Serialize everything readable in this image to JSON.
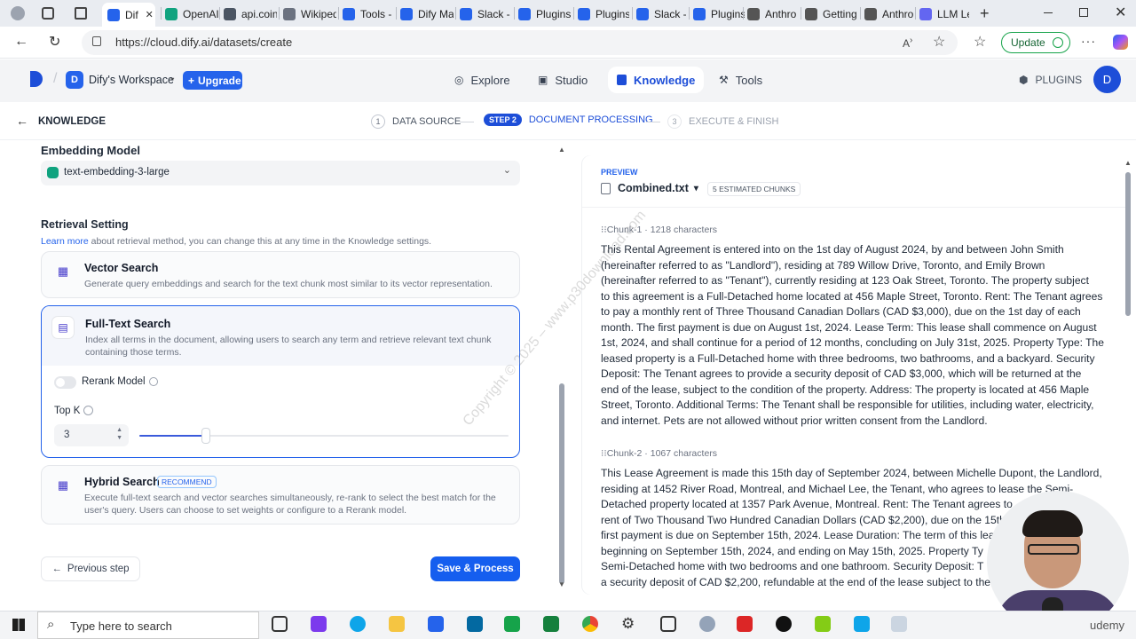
{
  "browser": {
    "tabs": [
      {
        "label": "Dif",
        "color": "#2563eb"
      },
      {
        "label": "OpenAI",
        "color": "#10a37f"
      },
      {
        "label": "api.coin",
        "color": "#4b5563"
      },
      {
        "label": "Wikiped",
        "color": "#6b7280"
      },
      {
        "label": "Tools -",
        "color": "#2563eb"
      },
      {
        "label": "Dify Ma",
        "color": "#2563eb"
      },
      {
        "label": "Slack -",
        "color": "#2563eb"
      },
      {
        "label": "Plugins",
        "color": "#2563eb"
      },
      {
        "label": "Plugins",
        "color": "#2563eb"
      },
      {
        "label": "Slack -",
        "color": "#2563eb"
      },
      {
        "label": "Plugins",
        "color": "#2563eb"
      },
      {
        "label": "Anthro",
        "color": "#555"
      },
      {
        "label": "Getting",
        "color": "#555"
      },
      {
        "label": "Anthro",
        "color": "#555"
      },
      {
        "label": "LLM Le",
        "color": "#6366f1"
      }
    ],
    "url": "https://cloud.dify.ai/datasets/create",
    "update_label": "Update"
  },
  "app": {
    "workspace_initial": "D",
    "workspace_name": "Dify's Workspace",
    "upgrade_label": "Upgrade",
    "nav": {
      "explore": "Explore",
      "studio": "Studio",
      "knowledge": "Knowledge",
      "tools": "Tools"
    },
    "plugins_label": "PLUGINS",
    "avatar_initial": "D"
  },
  "steps": {
    "back_label": "KNOWLEDGE",
    "step1_num": "1",
    "step1_label": "DATA SOURCE",
    "step2_num": "STEP 2",
    "step2_label": "DOCUMENT PROCESSING",
    "step3_num": "3",
    "step3_label": "EXECUTE & FINISH"
  },
  "settings": {
    "embedding_label": "Embedding Model",
    "embedding_value": "text-embedding-3-large",
    "retrieval_label": "Retrieval Setting",
    "learn_more": "Learn more",
    "retrieval_hint": " about retrieval method, you can change this at any time in the Knowledge settings.",
    "vector": {
      "title": "Vector Search",
      "desc": "Generate query embeddings and search for the text chunk most similar to its vector representation."
    },
    "fulltext": {
      "title": "Full-Text Search",
      "desc": "Index all terms in the document, allowing users to search any term and retrieve relevant text chunk containing those terms.",
      "rerank_label": "Rerank Model",
      "topk_label": "Top K",
      "topk_value": "3",
      "topk_fraction": 0.18
    },
    "hybrid": {
      "title": "Hybrid Search",
      "badge": "RECOMMEND",
      "desc": "Execute full-text search and vector searches simultaneously, re-rank to select the best match for the user's query. Users can choose to set weights or configure to a Rerank model."
    },
    "prev_label": "Previous step",
    "save_label": "Save & Process"
  },
  "preview": {
    "label": "PREVIEW",
    "file": "Combined.txt",
    "chunks_badge": "5 ESTIMATED CHUNKS",
    "chunk1_head": "Chunk-1",
    "chunk1_chars": "1218 characters",
    "chunk1_lines": [
      "This Rental Agreement is entered into on the 1st day of August 2024, by and between John Smith",
      "(hereinafter referred to as \"Landlord\"), residing at 789 Willow Drive, Toronto, and Emily Brown",
      "(hereinafter referred to as \"Tenant\"), currently residing at 123 Oak Street, Toronto. The property subject",
      "to this agreement is a Full-Detached home located at 456 Maple Street, Toronto. Rent: The Tenant agrees",
      "to pay a monthly rent of Three Thousand Canadian Dollars (CAD $3,000), due on the 1st day of each",
      "month. The first payment is due on August 1st, 2024. Lease Term: This lease shall commence on August",
      "1st, 2024, and shall continue for a period of 12 months, concluding on July 31st, 2025. Property Type: The",
      "leased property is a Full-Detached home with three bedrooms, two bathrooms, and a backyard. Security",
      "Deposit: The Tenant agrees to provide a security deposit of CAD $3,000, which will be returned at the",
      "end of the lease, subject to the condition of the property. Address: The property is located at 456 Maple",
      "Street, Toronto. Additional Terms: The Tenant shall be responsible for utilities, including water, electricity,",
      "and internet. Pets are not allowed without prior written consent from the Landlord."
    ],
    "chunk2_head": "Chunk-2",
    "chunk2_chars": "1067 characters",
    "chunk2_lines": [
      "This Lease Agreement is made this 15th day of September 2024, between Michelle Dupont, the Landlord,",
      "residing at 1452 River Road, Montreal, and Michael Lee, the Tenant, who agrees to lease the Semi-",
      "Detached property located at 1357 Park Avenue, Montreal. Rent: The Tenant agrees to",
      "rent of Two Thousand Two Hundred Canadian Dollars (CAD $2,200), due on the 15th",
      "first payment is due on September 15th, 2024. Lease Duration: The term of this lea",
      "beginning on September 15th, 2024, and ending on May 15th, 2025. Property Ty",
      "Semi-Detached home with two bedrooms and one bathroom. Security Deposit: T",
      "a security deposit of CAD $2,200, refundable at the end of the lease subject to the"
    ],
    "watermark": "Copyright © 2025 – www.p30download.com"
  },
  "taskbar": {
    "search_placeholder": "Type here to search",
    "udemy": "udemy"
  }
}
